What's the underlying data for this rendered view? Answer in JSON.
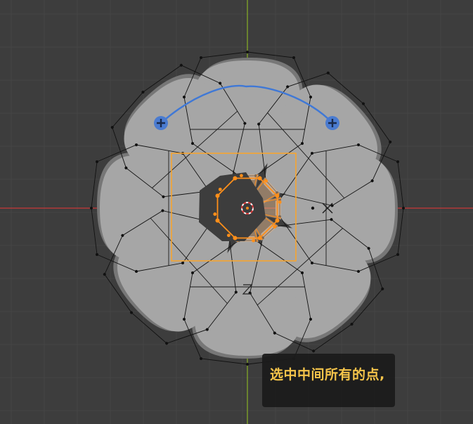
{
  "viewport": {
    "background": "#3d3d3d",
    "grid_color": "#454545",
    "x_axis_color": "#b03a3a",
    "y_axis_color": "#7a9a2a"
  },
  "petals": {
    "count": 8,
    "fill": "#a6a6a6",
    "shadow": "#777777",
    "cage_color": "#111111"
  },
  "selection": {
    "color": "#ff8f1a",
    "box_color": "#f7a530",
    "point_count": 8
  },
  "gizmo": {
    "arc_color": "#3f78d6",
    "handle_icon": "plus-icon"
  },
  "cursor": {
    "icon": "3d-cursor-icon"
  },
  "caption": {
    "text": "选中中间所有的点,"
  }
}
